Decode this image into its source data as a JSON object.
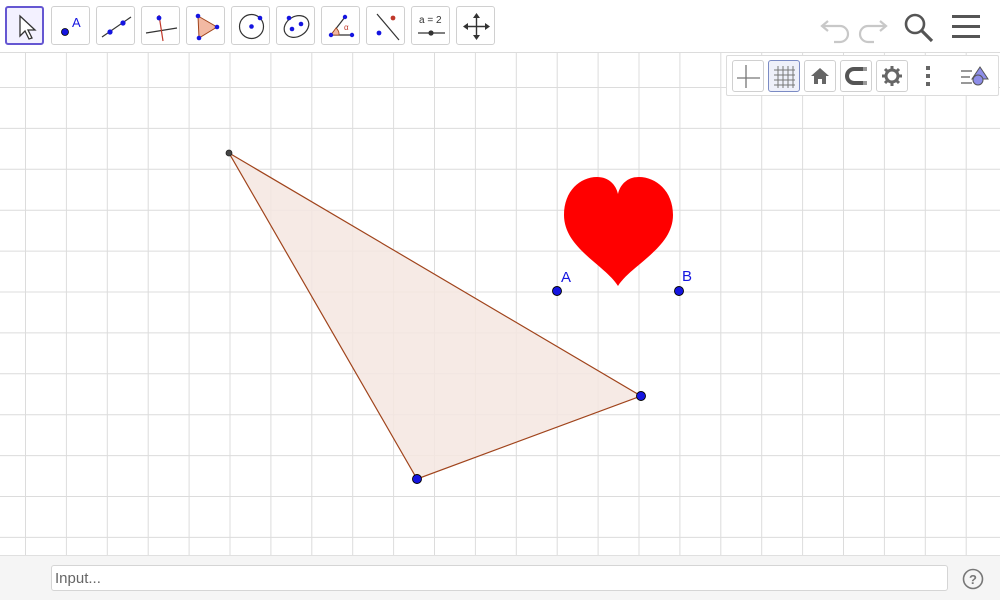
{
  "toolbar": {
    "tools": [
      {
        "name": "move-tool",
        "icon": "arrow-cursor-icon",
        "active": true
      },
      {
        "name": "point-tool",
        "icon": "point-icon",
        "label": "A"
      },
      {
        "name": "line-tool",
        "icon": "line-through-points-icon"
      },
      {
        "name": "perpendicular-line-tool",
        "icon": "perpendicular-line-icon"
      },
      {
        "name": "polygon-tool",
        "icon": "polygon-icon"
      },
      {
        "name": "circle-tool",
        "icon": "circle-center-point-icon"
      },
      {
        "name": "conic-tool",
        "icon": "ellipse-icon"
      },
      {
        "name": "angle-tool",
        "icon": "angle-icon",
        "label": "α"
      },
      {
        "name": "reflect-tool",
        "icon": "reflect-about-line-icon"
      },
      {
        "name": "slider-tool",
        "icon": "slider-icon",
        "label": "a = 2"
      },
      {
        "name": "move-graphics-view-tool",
        "icon": "move-arrows-icon"
      }
    ],
    "right": [
      {
        "name": "undo-button",
        "icon": "undo-icon"
      },
      {
        "name": "redo-button",
        "icon": "redo-icon"
      },
      {
        "name": "search-button",
        "icon": "search-icon"
      },
      {
        "name": "menu-button",
        "icon": "hamburger-menu-icon"
      }
    ]
  },
  "style_bar": {
    "buttons": [
      {
        "name": "axes-toggle",
        "icon": "axes-icon"
      },
      {
        "name": "grid-toggle",
        "icon": "grid-icon",
        "on": true
      },
      {
        "name": "standard-view-button",
        "icon": "home-icon"
      },
      {
        "name": "point-capturing-button",
        "icon": "magnet-icon"
      },
      {
        "name": "graphics-settings-button",
        "icon": "gear-icon"
      },
      {
        "name": "more-options-button",
        "icon": "more-vertical-icon"
      },
      {
        "name": "algebra-view-toggle",
        "icon": "algebra-shapes-icon"
      }
    ]
  },
  "canvas": {
    "grid_color": "#dcdcdc",
    "triangle": {
      "fill": "#f5e6e0",
      "stroke": "#a0441c"
    },
    "points": [
      {
        "id": "A",
        "label": "A",
        "color": "#1515e0"
      },
      {
        "id": "B",
        "label": "B",
        "color": "#1515e0"
      }
    ],
    "heart_color": "#ff0000"
  },
  "input": {
    "placeholder": "Input..."
  },
  "help": {
    "icon": "help-circle-icon",
    "label": "?"
  }
}
